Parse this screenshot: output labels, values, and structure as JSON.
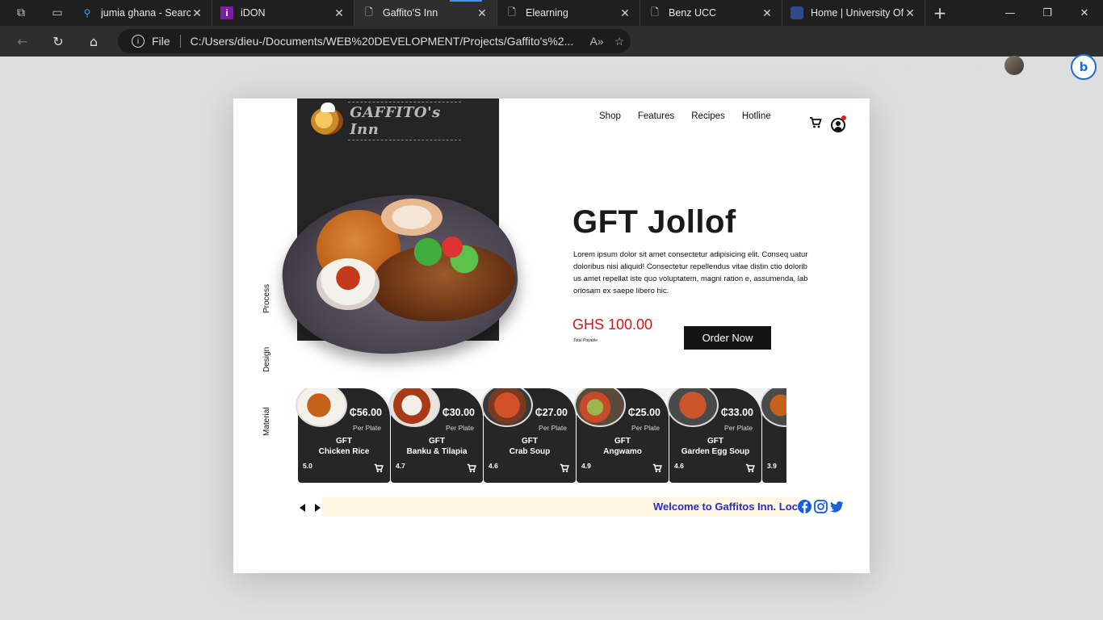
{
  "browser": {
    "tabs": [
      {
        "label": "jumia ghana - Search",
        "icon": "search-icon"
      },
      {
        "label": "iDON",
        "icon": "idon-icon"
      },
      {
        "label": "Gaffito'S Inn",
        "icon": "page-icon",
        "active": true
      },
      {
        "label": "Elearning",
        "icon": "page-icon"
      },
      {
        "label": "Benz UCC",
        "icon": "page-icon"
      },
      {
        "label": "Home | University Of",
        "icon": "crest-icon"
      }
    ],
    "address": {
      "scheme_label": "File",
      "url": "C:/Users/dieu-/Documents/WEB%20DEVELOPMENT/Projects/Gaffito's%2..."
    }
  },
  "site": {
    "logo_text": "GAFFITO's Inn",
    "nav": [
      "Shop",
      "Features",
      "Recipes",
      "Hotline"
    ],
    "side_labels": [
      "Process",
      "Design",
      "Material"
    ],
    "hero": {
      "title": "GFT Jollof",
      "description": "Lorem ipsum dolor sit amet consectetur adipisicing elit. Conseq uatur doloribus nisi aliquid! Consectetur repellendus vitae distin ctio doloribus amet repellat iste quo voluptatem, magni ration e, assumenda, laboriosam ex saepe libero hic.",
      "price": "GHS 100.00",
      "price_caption": "Total Payable",
      "order_label": "Order Now"
    },
    "cards": [
      {
        "price": "₵56.00",
        "per": "Per Plate",
        "brand": "GFT",
        "name": "Chicken Rice",
        "rating": "5.0"
      },
      {
        "price": "₵30.00",
        "per": "Per Plate",
        "brand": "GFT",
        "name": "Banku & Tilapia",
        "rating": "4.7"
      },
      {
        "price": "₵27.00",
        "per": "Per Plate",
        "brand": "GFT",
        "name": "Crab Soup",
        "rating": "4.6"
      },
      {
        "price": "₵25.00",
        "per": "Per Plate",
        "brand": "GFT",
        "name": "Angwamo",
        "rating": "4.9"
      },
      {
        "price": "₵33.00",
        "per": "Per Plate",
        "brand": "GFT",
        "name": "Garden Egg Soup",
        "rating": "4.6"
      },
      {
        "price": "",
        "per": "",
        "brand": "",
        "name": "",
        "rating": "3.9"
      }
    ],
    "ticker": "Welcome to Gaffitos Inn. Loca",
    "colors": {
      "accent_price": "#d01818",
      "ticker_text": "#2a2ac8",
      "ticker_bg": "#fdf6e2",
      "dark": "#262626"
    }
  }
}
